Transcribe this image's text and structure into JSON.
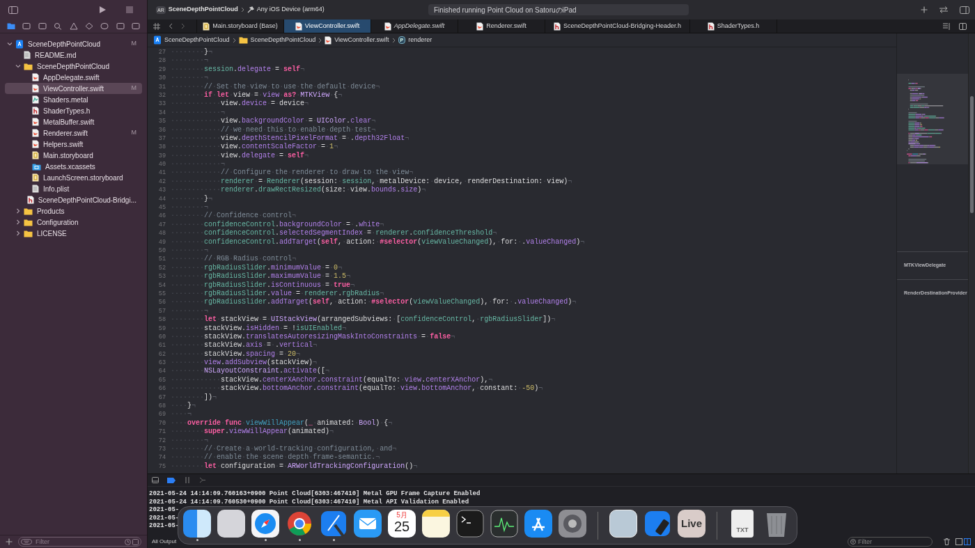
{
  "toolbar": {
    "scheme": "SceneDepthPointCloud",
    "scheme_badge": "AR",
    "destination": "Any iOS Device (arm64)",
    "status": "Finished running Point Cloud on SatoruのiPad"
  },
  "sidebar": {
    "tree": [
      {
        "name": "SceneDepthPointCloud",
        "kind": "project",
        "badge": "M",
        "selected": false,
        "expanded": true,
        "children": [
          {
            "name": "README.md",
            "kind": "doc",
            "selected": false
          },
          {
            "name": "SceneDepthPointCloud",
            "kind": "folder",
            "selected": false,
            "expanded": true,
            "children": [
              {
                "name": "AppDelegate.swift",
                "kind": "swift",
                "selected": false
              },
              {
                "name": "ViewController.swift",
                "kind": "swift",
                "badge": "M",
                "selected": true
              },
              {
                "name": "Shaders.metal",
                "kind": "metal",
                "selected": false
              },
              {
                "name": "ShaderTypes.h",
                "kind": "header",
                "selected": false
              },
              {
                "name": "MetalBuffer.swift",
                "kind": "swift",
                "selected": false
              },
              {
                "name": "Renderer.swift",
                "kind": "swift",
                "badge": "M",
                "selected": false
              },
              {
                "name": "Helpers.swift",
                "kind": "swift",
                "selected": false
              },
              {
                "name": "Main.storyboard",
                "kind": "storyboard",
                "selected": false
              },
              {
                "name": "Assets.xcassets",
                "kind": "assets",
                "selected": false
              },
              {
                "name": "LaunchScreen.storyboard",
                "kind": "storyboard",
                "selected": false
              },
              {
                "name": "Info.plist",
                "kind": "doc",
                "selected": false
              },
              {
                "name": "SceneDepthPointCloud-Bridgi...",
                "kind": "header",
                "selected": false
              }
            ]
          },
          {
            "name": "Products",
            "kind": "folder",
            "selected": false,
            "expanded": false
          },
          {
            "name": "Configuration",
            "kind": "folder",
            "selected": false,
            "expanded": false
          },
          {
            "name": "LICENSE",
            "kind": "folder",
            "selected": false,
            "expanded": false
          }
        ]
      }
    ],
    "filter_placeholder": "Filter"
  },
  "tabs": [
    {
      "label": "Main.storyboard (Base)",
      "kind": "storyboard",
      "selected": false,
      "preview": false
    },
    {
      "label": "ViewController.swift",
      "kind": "swift",
      "selected": true,
      "preview": false
    },
    {
      "label": "AppDelegate.swift",
      "kind": "swift",
      "selected": false,
      "preview": true
    },
    {
      "label": "Renderer.swift",
      "kind": "swift",
      "selected": false,
      "preview": false
    },
    {
      "label": "SceneDepthPointCloud-Bridging-Header.h",
      "kind": "header",
      "selected": false,
      "preview": false
    },
    {
      "label": "ShaderTypes.h",
      "kind": "header",
      "selected": false,
      "preview": false
    }
  ],
  "breadcrumb": [
    {
      "label": "SceneDepthPointCloud",
      "kind": "project"
    },
    {
      "label": "SceneDepthPointCloud",
      "kind": "folder"
    },
    {
      "label": "ViewController.swift",
      "kind": "swift"
    },
    {
      "label": "renderer",
      "kind": "property",
      "symbol": "P"
    }
  ],
  "code": [
    {
      "n": "27",
      "tokens": [
        {
          "kind": "plain",
          "text": "········}"
        },
        {
          "kind": "eol",
          "text": "¬"
        }
      ]
    },
    {
      "n": "28",
      "tokens": [
        {
          "kind": "plain",
          "text": "········"
        },
        {
          "kind": "eol",
          "text": "¬"
        }
      ]
    },
    {
      "n": "29",
      "tokens": [
        {
          "kind": "plain",
          "text": "········"
        },
        {
          "kind": "project",
          "text": "session"
        },
        {
          "kind": "plain",
          "text": "."
        },
        {
          "kind": "system",
          "text": "delegate"
        },
        {
          "kind": "plain",
          "text": "·=·"
        },
        {
          "kind": "keyword",
          "text": "self"
        },
        {
          "kind": "eol",
          "text": "¬"
        }
      ]
    },
    {
      "n": "30",
      "tokens": [
        {
          "kind": "plain",
          "text": "········"
        },
        {
          "kind": "eol",
          "text": "¬"
        }
      ]
    },
    {
      "n": "31",
      "tokens": [
        {
          "kind": "plain",
          "text": "········"
        },
        {
          "kind": "comment",
          "text": "//·Set·the·view·to·use·the·default·device"
        },
        {
          "kind": "eol",
          "text": "¬"
        }
      ]
    },
    {
      "n": "32",
      "tokens": [
        {
          "kind": "plain",
          "text": "········"
        },
        {
          "kind": "keyword",
          "text": "if·let"
        },
        {
          "kind": "plain",
          "text": "·view·=·"
        },
        {
          "kind": "system",
          "text": "view"
        },
        {
          "kind": "plain",
          "text": "·"
        },
        {
          "kind": "keyword",
          "text": "as?"
        },
        {
          "kind": "plain",
          "text": "·"
        },
        {
          "kind": "type",
          "text": "MTKView"
        },
        {
          "kind": "plain",
          "text": "·{"
        },
        {
          "kind": "eol",
          "text": "¬"
        }
      ]
    },
    {
      "n": "33",
      "tokens": [
        {
          "kind": "plain",
          "text": "············view."
        },
        {
          "kind": "system",
          "text": "device"
        },
        {
          "kind": "plain",
          "text": "·=·device"
        },
        {
          "kind": "eol",
          "text": "¬"
        }
      ]
    },
    {
      "n": "34",
      "tokens": [
        {
          "kind": "plain",
          "text": "············"
        },
        {
          "kind": "eol",
          "text": "¬"
        }
      ]
    },
    {
      "n": "35",
      "tokens": [
        {
          "kind": "plain",
          "text": "············view."
        },
        {
          "kind": "system",
          "text": "backgroundColor"
        },
        {
          "kind": "plain",
          "text": "·=·"
        },
        {
          "kind": "type",
          "text": "UIColor"
        },
        {
          "kind": "plain",
          "text": "."
        },
        {
          "kind": "system",
          "text": "clear"
        },
        {
          "kind": "eol",
          "text": "¬"
        }
      ]
    },
    {
      "n": "36",
      "tokens": [
        {
          "kind": "plain",
          "text": "············"
        },
        {
          "kind": "comment",
          "text": "//·we·need·this·to·enable·depth·test"
        },
        {
          "kind": "eol",
          "text": "¬"
        }
      ]
    },
    {
      "n": "37",
      "tokens": [
        {
          "kind": "plain",
          "text": "············view."
        },
        {
          "kind": "system",
          "text": "depthStencilPixelFormat"
        },
        {
          "kind": "plain",
          "text": "·=·."
        },
        {
          "kind": "system",
          "text": "depth32Float"
        },
        {
          "kind": "eol",
          "text": "¬"
        }
      ]
    },
    {
      "n": "38",
      "tokens": [
        {
          "kind": "plain",
          "text": "············view."
        },
        {
          "kind": "system",
          "text": "contentScaleFactor"
        },
        {
          "kind": "plain",
          "text": "·=·"
        },
        {
          "kind": "number",
          "text": "1"
        },
        {
          "kind": "eol",
          "text": "¬"
        }
      ]
    },
    {
      "n": "39",
      "tokens": [
        {
          "kind": "plain",
          "text": "············view."
        },
        {
          "kind": "system",
          "text": "delegate"
        },
        {
          "kind": "plain",
          "text": "·=·"
        },
        {
          "kind": "keyword",
          "text": "self"
        },
        {
          "kind": "eol",
          "text": "¬"
        }
      ]
    },
    {
      "n": "40",
      "tokens": [
        {
          "kind": "plain",
          "text": "············"
        },
        {
          "kind": "eol",
          "text": "¬"
        }
      ]
    },
    {
      "n": "41",
      "tokens": [
        {
          "kind": "plain",
          "text": "············"
        },
        {
          "kind": "comment",
          "text": "//·Configure·the·renderer·to·draw·to·the·view"
        },
        {
          "kind": "eol",
          "text": "¬"
        }
      ]
    },
    {
      "n": "42",
      "tokens": [
        {
          "kind": "plain",
          "text": "············"
        },
        {
          "kind": "project",
          "text": "renderer"
        },
        {
          "kind": "plain",
          "text": "·=·"
        },
        {
          "kind": "project",
          "text": "Renderer"
        },
        {
          "kind": "plain",
          "text": "(session:·"
        },
        {
          "kind": "project",
          "text": "session"
        },
        {
          "kind": "plain",
          "text": ",·metalDevice:·device,·renderDestination:·view)"
        },
        {
          "kind": "eol",
          "text": "¬"
        }
      ]
    },
    {
      "n": "43",
      "tokens": [
        {
          "kind": "plain",
          "text": "············"
        },
        {
          "kind": "project",
          "text": "renderer"
        },
        {
          "kind": "plain",
          "text": "."
        },
        {
          "kind": "project",
          "text": "drawRectResized"
        },
        {
          "kind": "plain",
          "text": "(size:·view."
        },
        {
          "kind": "system",
          "text": "bounds"
        },
        {
          "kind": "plain",
          "text": "."
        },
        {
          "kind": "system",
          "text": "size"
        },
        {
          "kind": "plain",
          "text": ")"
        },
        {
          "kind": "eol",
          "text": "¬"
        }
      ]
    },
    {
      "n": "44",
      "tokens": [
        {
          "kind": "plain",
          "text": "········}"
        },
        {
          "kind": "eol",
          "text": "¬"
        }
      ]
    },
    {
      "n": "45",
      "tokens": [
        {
          "kind": "plain",
          "text": "········"
        },
        {
          "kind": "eol",
          "text": "¬"
        }
      ]
    },
    {
      "n": "46",
      "tokens": [
        {
          "kind": "plain",
          "text": "········"
        },
        {
          "kind": "comment",
          "text": "//·Confidence·control"
        },
        {
          "kind": "eol",
          "text": "¬"
        }
      ]
    },
    {
      "n": "47",
      "tokens": [
        {
          "kind": "plain",
          "text": "········"
        },
        {
          "kind": "project",
          "text": "confidenceControl"
        },
        {
          "kind": "plain",
          "text": "."
        },
        {
          "kind": "system",
          "text": "backgroundColor"
        },
        {
          "kind": "plain",
          "text": "·=·."
        },
        {
          "kind": "system",
          "text": "white"
        },
        {
          "kind": "eol",
          "text": "¬"
        }
      ]
    },
    {
      "n": "48",
      "tokens": [
        {
          "kind": "plain",
          "text": "········"
        },
        {
          "kind": "project",
          "text": "confidenceControl"
        },
        {
          "kind": "plain",
          "text": "."
        },
        {
          "kind": "system",
          "text": "selectedSegmentIndex"
        },
        {
          "kind": "plain",
          "text": "·=·"
        },
        {
          "kind": "project",
          "text": "renderer"
        },
        {
          "kind": "plain",
          "text": "."
        },
        {
          "kind": "project",
          "text": "confidenceThreshold"
        },
        {
          "kind": "eol",
          "text": "¬"
        }
      ]
    },
    {
      "n": "49",
      "tokens": [
        {
          "kind": "plain",
          "text": "········"
        },
        {
          "kind": "project",
          "text": "confidenceControl"
        },
        {
          "kind": "plain",
          "text": "."
        },
        {
          "kind": "system",
          "text": "addTarget"
        },
        {
          "kind": "plain",
          "text": "("
        },
        {
          "kind": "keyword",
          "text": "self"
        },
        {
          "kind": "plain",
          "text": ",·action:·"
        },
        {
          "kind": "keyword",
          "text": "#selector"
        },
        {
          "kind": "plain",
          "text": "("
        },
        {
          "kind": "project",
          "text": "viewValueChanged"
        },
        {
          "kind": "plain",
          "text": "),·for:·."
        },
        {
          "kind": "system",
          "text": "valueChanged"
        },
        {
          "kind": "plain",
          "text": ")"
        },
        {
          "kind": "eol",
          "text": "¬"
        }
      ]
    },
    {
      "n": "50",
      "tokens": [
        {
          "kind": "plain",
          "text": "········"
        },
        {
          "kind": "eol",
          "text": "¬"
        }
      ]
    },
    {
      "n": "51",
      "tokens": [
        {
          "kind": "plain",
          "text": "········"
        },
        {
          "kind": "comment",
          "text": "//·RGB·Radius·control"
        },
        {
          "kind": "eol",
          "text": "¬"
        }
      ]
    },
    {
      "n": "52",
      "tokens": [
        {
          "kind": "plain",
          "text": "········"
        },
        {
          "kind": "project",
          "text": "rgbRadiusSlider"
        },
        {
          "kind": "plain",
          "text": "."
        },
        {
          "kind": "system",
          "text": "minimumValue"
        },
        {
          "kind": "plain",
          "text": "·=·"
        },
        {
          "kind": "number",
          "text": "0"
        },
        {
          "kind": "eol",
          "text": "¬"
        }
      ]
    },
    {
      "n": "53",
      "tokens": [
        {
          "kind": "plain",
          "text": "········"
        },
        {
          "kind": "project",
          "text": "rgbRadiusSlider"
        },
        {
          "kind": "plain",
          "text": "."
        },
        {
          "kind": "system",
          "text": "maximumValue"
        },
        {
          "kind": "plain",
          "text": "·=·"
        },
        {
          "kind": "number",
          "text": "1.5"
        },
        {
          "kind": "eol",
          "text": "¬"
        }
      ]
    },
    {
      "n": "54",
      "tokens": [
        {
          "kind": "plain",
          "text": "········"
        },
        {
          "kind": "project",
          "text": "rgbRadiusSlider"
        },
        {
          "kind": "plain",
          "text": "."
        },
        {
          "kind": "system",
          "text": "isContinuous"
        },
        {
          "kind": "plain",
          "text": "·=·"
        },
        {
          "kind": "keyword",
          "text": "true"
        },
        {
          "kind": "eol",
          "text": "¬"
        }
      ]
    },
    {
      "n": "55",
      "tokens": [
        {
          "kind": "plain",
          "text": "········"
        },
        {
          "kind": "project",
          "text": "rgbRadiusSlider"
        },
        {
          "kind": "plain",
          "text": "."
        },
        {
          "kind": "system",
          "text": "value"
        },
        {
          "kind": "plain",
          "text": "·=·"
        },
        {
          "kind": "project",
          "text": "renderer"
        },
        {
          "kind": "plain",
          "text": "."
        },
        {
          "kind": "project",
          "text": "rgbRadius"
        },
        {
          "kind": "eol",
          "text": "¬"
        }
      ]
    },
    {
      "n": "56",
      "tokens": [
        {
          "kind": "plain",
          "text": "········"
        },
        {
          "kind": "project",
          "text": "rgbRadiusSlider"
        },
        {
          "kind": "plain",
          "text": "."
        },
        {
          "kind": "system",
          "text": "addTarget"
        },
        {
          "kind": "plain",
          "text": "("
        },
        {
          "kind": "keyword",
          "text": "self"
        },
        {
          "kind": "plain",
          "text": ",·action:·"
        },
        {
          "kind": "keyword",
          "text": "#selector"
        },
        {
          "kind": "plain",
          "text": "("
        },
        {
          "kind": "project",
          "text": "viewValueChanged"
        },
        {
          "kind": "plain",
          "text": "),·for:·."
        },
        {
          "kind": "system",
          "text": "valueChanged"
        },
        {
          "kind": "plain",
          "text": ")"
        },
        {
          "kind": "eol",
          "text": "¬"
        }
      ]
    },
    {
      "n": "57",
      "tokens": [
        {
          "kind": "plain",
          "text": "········"
        },
        {
          "kind": "eol",
          "text": "¬"
        }
      ]
    },
    {
      "n": "58",
      "tokens": [
        {
          "kind": "plain",
          "text": "········"
        },
        {
          "kind": "keyword",
          "text": "let"
        },
        {
          "kind": "plain",
          "text": "·stackView·=·"
        },
        {
          "kind": "type",
          "text": "UIStackView"
        },
        {
          "kind": "plain",
          "text": "(arrangedSubviews:·["
        },
        {
          "kind": "project",
          "text": "confidenceControl"
        },
        {
          "kind": "plain",
          "text": ",·"
        },
        {
          "kind": "project",
          "text": "rgbRadiusSlider"
        },
        {
          "kind": "plain",
          "text": "])"
        },
        {
          "kind": "eol",
          "text": "¬"
        }
      ]
    },
    {
      "n": "59",
      "tokens": [
        {
          "kind": "plain",
          "text": "········stackView."
        },
        {
          "kind": "system",
          "text": "isHidden"
        },
        {
          "kind": "plain",
          "text": "·=·!"
        },
        {
          "kind": "project",
          "text": "isUIEnabled"
        },
        {
          "kind": "eol",
          "text": "¬"
        }
      ]
    },
    {
      "n": "60",
      "tokens": [
        {
          "kind": "plain",
          "text": "········stackView."
        },
        {
          "kind": "system",
          "text": "translatesAutoresizingMaskIntoConstraints"
        },
        {
          "kind": "plain",
          "text": "·=·"
        },
        {
          "kind": "keyword",
          "text": "false"
        },
        {
          "kind": "eol",
          "text": "¬"
        }
      ]
    },
    {
      "n": "61",
      "tokens": [
        {
          "kind": "plain",
          "text": "········stackView."
        },
        {
          "kind": "system",
          "text": "axis"
        },
        {
          "kind": "plain",
          "text": "·=·."
        },
        {
          "kind": "system",
          "text": "vertical"
        },
        {
          "kind": "eol",
          "text": "¬"
        }
      ]
    },
    {
      "n": "62",
      "tokens": [
        {
          "kind": "plain",
          "text": "········stackView."
        },
        {
          "kind": "system",
          "text": "spacing"
        },
        {
          "kind": "plain",
          "text": "·=·"
        },
        {
          "kind": "number",
          "text": "20"
        },
        {
          "kind": "eol",
          "text": "¬"
        }
      ]
    },
    {
      "n": "63",
      "tokens": [
        {
          "kind": "plain",
          "text": "········"
        },
        {
          "kind": "system",
          "text": "view"
        },
        {
          "kind": "plain",
          "text": "."
        },
        {
          "kind": "system",
          "text": "addSubview"
        },
        {
          "kind": "plain",
          "text": "(stackView)"
        },
        {
          "kind": "eol",
          "text": "¬"
        }
      ]
    },
    {
      "n": "64",
      "tokens": [
        {
          "kind": "plain",
          "text": "········"
        },
        {
          "kind": "type",
          "text": "NSLayoutConstraint"
        },
        {
          "kind": "plain",
          "text": "."
        },
        {
          "kind": "system",
          "text": "activate"
        },
        {
          "kind": "plain",
          "text": "(["
        },
        {
          "kind": "eol",
          "text": "¬"
        }
      ]
    },
    {
      "n": "65",
      "tokens": [
        {
          "kind": "plain",
          "text": "············stackView."
        },
        {
          "kind": "system",
          "text": "centerXAnchor"
        },
        {
          "kind": "plain",
          "text": "."
        },
        {
          "kind": "system",
          "text": "constraint"
        },
        {
          "kind": "plain",
          "text": "(equalTo:·"
        },
        {
          "kind": "system",
          "text": "view"
        },
        {
          "kind": "plain",
          "text": "."
        },
        {
          "kind": "system",
          "text": "centerXAnchor"
        },
        {
          "kind": "plain",
          "text": "),"
        },
        {
          "kind": "eol",
          "text": "¬"
        }
      ]
    },
    {
      "n": "66",
      "tokens": [
        {
          "kind": "plain",
          "text": "············stackView."
        },
        {
          "kind": "system",
          "text": "bottomAnchor"
        },
        {
          "kind": "plain",
          "text": "."
        },
        {
          "kind": "system",
          "text": "constraint"
        },
        {
          "kind": "plain",
          "text": "(equalTo:·"
        },
        {
          "kind": "system",
          "text": "view"
        },
        {
          "kind": "plain",
          "text": "."
        },
        {
          "kind": "system",
          "text": "bottomAnchor"
        },
        {
          "kind": "plain",
          "text": ",·constant:·"
        },
        {
          "kind": "number",
          "text": "-50"
        },
        {
          "kind": "plain",
          "text": ")"
        },
        {
          "kind": "eol",
          "text": "¬"
        }
      ]
    },
    {
      "n": "67",
      "tokens": [
        {
          "kind": "plain",
          "text": "········])"
        },
        {
          "kind": "eol",
          "text": "¬"
        }
      ]
    },
    {
      "n": "68",
      "tokens": [
        {
          "kind": "plain",
          "text": "····}"
        },
        {
          "kind": "eol",
          "text": "¬"
        }
      ]
    },
    {
      "n": "69",
      "tokens": [
        {
          "kind": "plain",
          "text": "····"
        },
        {
          "kind": "eol",
          "text": "¬"
        }
      ]
    },
    {
      "n": "70",
      "tokens": [
        {
          "kind": "plain",
          "text": "····"
        },
        {
          "kind": "keyword",
          "text": "override·func"
        },
        {
          "kind": "plain",
          "text": "·"
        },
        {
          "kind": "decl",
          "text": "viewWillAppear"
        },
        {
          "kind": "plain",
          "text": "("
        },
        {
          "kind": "keyword",
          "text": "_"
        },
        {
          "kind": "plain",
          "text": "·animated:·"
        },
        {
          "kind": "type",
          "text": "Bool"
        },
        {
          "kind": "plain",
          "text": ")·{"
        },
        {
          "kind": "eol",
          "text": "¬"
        }
      ]
    },
    {
      "n": "71",
      "tokens": [
        {
          "kind": "plain",
          "text": "········"
        },
        {
          "kind": "keyword",
          "text": "super"
        },
        {
          "kind": "plain",
          "text": "."
        },
        {
          "kind": "system",
          "text": "viewWillAppear"
        },
        {
          "kind": "plain",
          "text": "(animated)"
        },
        {
          "kind": "eol",
          "text": "¬"
        }
      ]
    },
    {
      "n": "72",
      "tokens": [
        {
          "kind": "plain",
          "text": "········"
        },
        {
          "kind": "eol",
          "text": "¬"
        }
      ]
    },
    {
      "n": "73",
      "tokens": [
        {
          "kind": "plain",
          "text": "········"
        },
        {
          "kind": "comment",
          "text": "//·Create·a·world-tracking·configuration,·and"
        },
        {
          "kind": "eol",
          "text": "¬"
        }
      ]
    },
    {
      "n": "74",
      "tokens": [
        {
          "kind": "plain",
          "text": "········"
        },
        {
          "kind": "comment",
          "text": "//·enable·the·scene·depth·frame-semantic."
        },
        {
          "kind": "eol",
          "text": "¬"
        }
      ]
    },
    {
      "n": "75",
      "tokens": [
        {
          "kind": "plain",
          "text": "········"
        },
        {
          "kind": "keyword",
          "text": "let"
        },
        {
          "kind": "plain",
          "text": "·configuration·=·"
        },
        {
          "kind": "type",
          "text": "ARWorldTrackingConfiguration"
        },
        {
          "kind": "plain",
          "text": "()"
        },
        {
          "kind": "eol",
          "text": "¬"
        }
      ]
    }
  ],
  "minimap": {
    "sections": [
      "MTKViewDelegate",
      "RenderDestinationProvider"
    ]
  },
  "console": {
    "lines": [
      "2021-05-24 14:14:09.760163+0900 Point Cloud[6303:467410] Metal GPU Frame Capture Enabled",
      "2021-05-24 14:14:09.760530+0900 Point Cloud[6303:467410] Metal API Validation Enabled",
      "2021-05-",
      "2021-05-",
      "2021-05-"
    ],
    "output_menu": "All Output",
    "filter_placeholder": "Filter"
  },
  "dock": {
    "items": [
      {
        "kind": "finder",
        "running": true
      },
      {
        "kind": "launchpad",
        "running": false
      },
      {
        "kind": "safari",
        "running": true
      },
      {
        "kind": "chrome",
        "running": true
      },
      {
        "kind": "xcode",
        "running": true
      },
      {
        "kind": "mail",
        "running": false
      },
      {
        "kind": "calendar",
        "month": "5月",
        "day": "25",
        "running": false
      },
      {
        "kind": "notes",
        "running": false
      },
      {
        "kind": "terminal",
        "running": false
      },
      {
        "kind": "activity",
        "running": false
      },
      {
        "kind": "appstore",
        "running": false
      },
      {
        "kind": "settings",
        "running": false
      },
      {
        "kind": "separator"
      },
      {
        "kind": "photo",
        "running": false
      },
      {
        "kind": "simulator",
        "running": false
      },
      {
        "kind": "live",
        "label": "Live",
        "running": false
      },
      {
        "kind": "separator"
      },
      {
        "kind": "file",
        "label": "TXT",
        "running": false
      },
      {
        "kind": "trash",
        "running": false
      }
    ]
  }
}
